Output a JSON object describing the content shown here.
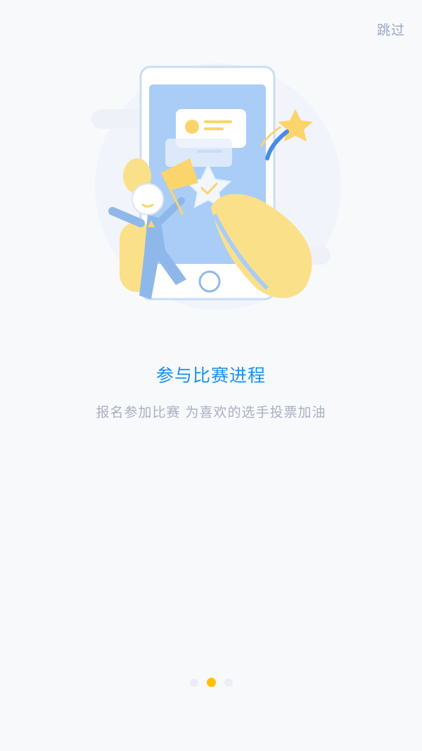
{
  "skip_label": "跳过",
  "title": "参与比赛进程",
  "subtitle": "报名参加比赛 为喜欢的选手投票加油",
  "pager": {
    "count": 3,
    "active_index": 1
  },
  "colors": {
    "accent": "#1890f0",
    "indicator_active": "#ffc107",
    "indicator_inactive": "#eceef3"
  },
  "illustration_icon": "phone-vote-icon"
}
